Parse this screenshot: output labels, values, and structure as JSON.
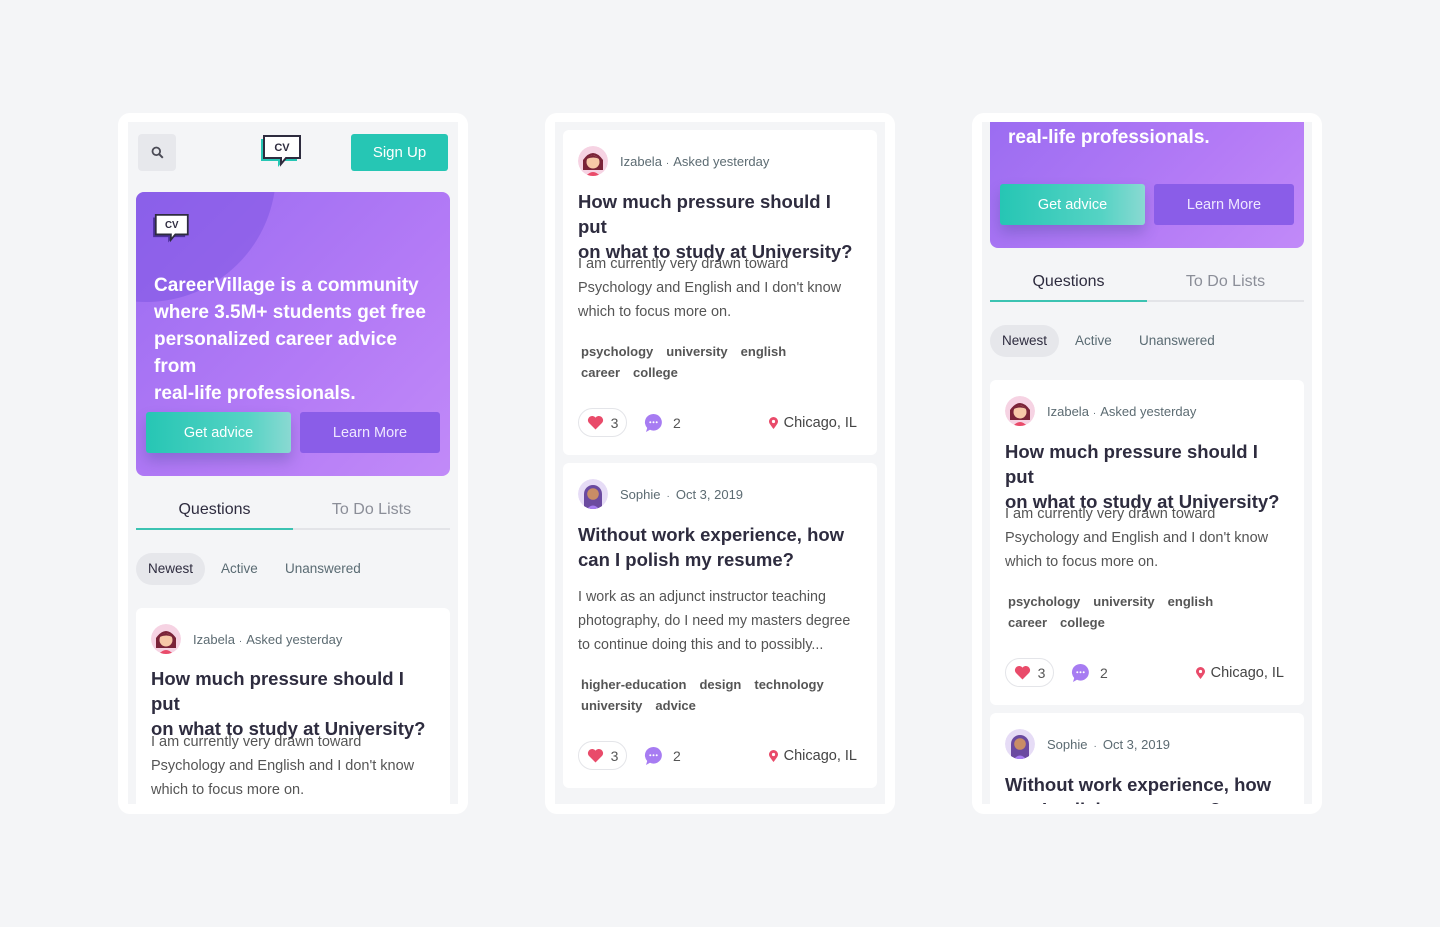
{
  "header": {
    "signup_label": "Sign Up",
    "logo_text": "CV"
  },
  "hero": {
    "logo_text": "CV",
    "lines": [
      "CareerVillage is a community",
      "where 3.5M+ students get free",
      "personalized career advice from",
      "real-life professionals."
    ],
    "last_line": "real-life professionals.",
    "advice_label": "Get advice",
    "learn_label": "Learn More"
  },
  "tabs": {
    "questions": "Questions",
    "todo": "To Do Lists"
  },
  "filters": {
    "newest": "Newest",
    "active": "Active",
    "unanswered": "Unanswered"
  },
  "questions": [
    {
      "author": "Izabela",
      "dot": "·",
      "when_prefix": "Asked",
      "when": "yesterday",
      "title_lines": [
        "How much pressure should I put",
        "on what to study at University?"
      ],
      "body_lines": [
        "I am currently very drawn toward",
        "Psychology and English and I don't know",
        "which to focus more on."
      ],
      "tags": [
        "psychology",
        "university",
        "english",
        "career",
        "college"
      ],
      "likes": "3",
      "comments": "2",
      "location": "Chicago, IL"
    },
    {
      "author": "Sophie",
      "dot": "·",
      "when": "Oct 3, 2019",
      "title_lines": [
        "Without work experience, how",
        "can I polish my resume?"
      ],
      "body_lines": [
        "I work as an adjunct instructor teaching",
        "photography, do I need my masters degree",
        "to continue doing this  and to possibly..."
      ],
      "tags": [
        "higher-education",
        "design",
        "technology",
        "university",
        "advice"
      ],
      "likes": "3",
      "comments": "2",
      "location": "Chicago, IL"
    }
  ],
  "colors": {
    "teal": "#26c6b4",
    "purple": "#9a6cf1",
    "heart": "#e94b6a",
    "comment": "#a77cf2"
  },
  "icons": [
    "search-icon",
    "cv-logo-icon",
    "heart-icon",
    "comment-icon",
    "location-pin-icon"
  ]
}
